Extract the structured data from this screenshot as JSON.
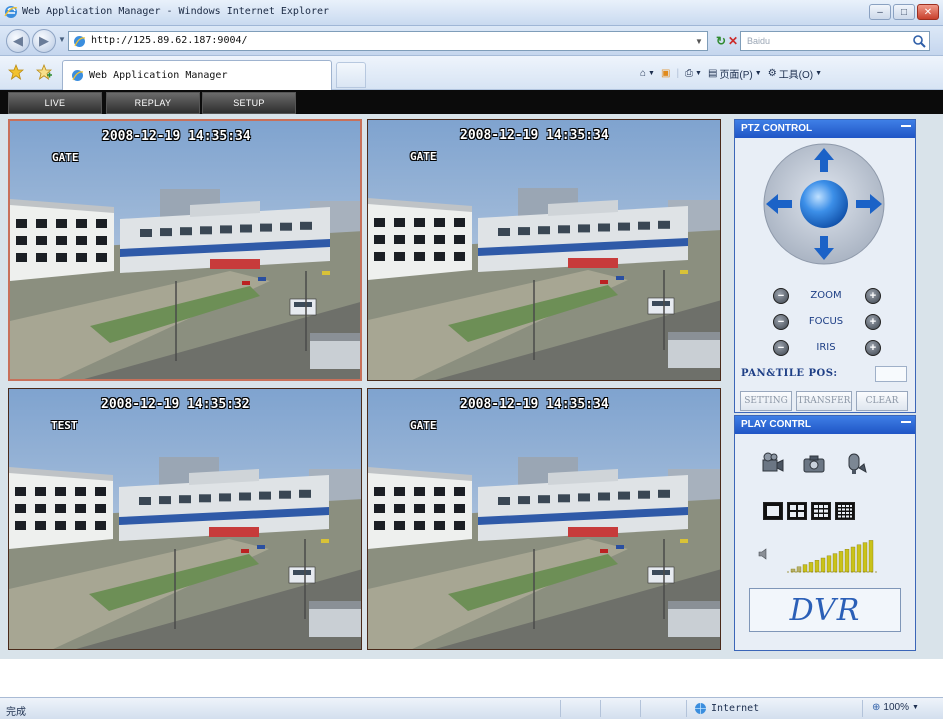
{
  "browser": {
    "window_title": "Web Application Manager - Windows Internet Explorer",
    "address": "http://125.89.62.187:9004/",
    "search_placeholder": "Baidu",
    "tab_title": "Web Application Manager",
    "commands": {
      "page": "页面(P)",
      "tools": "工具(O)"
    },
    "status": "完成",
    "zone": "Internet",
    "zoom": "100%"
  },
  "app": {
    "nav": [
      {
        "label": "LIVE"
      },
      {
        "label": "REPLAY"
      },
      {
        "label": "SETUP"
      }
    ],
    "cameras": [
      {
        "timestamp": "2008-12-19 14:35:34",
        "name": "GATE"
      },
      {
        "timestamp": "2008-12-19 14:35:34",
        "name": "GATE"
      },
      {
        "timestamp": "2008-12-19 14:35:32",
        "name": "TEST"
      },
      {
        "timestamp": "2008-12-19 14:35:34",
        "name": "GATE"
      }
    ],
    "ptz": {
      "title": "PTZ CONTROL",
      "zoom": "ZOOM",
      "focus": "FOCUS",
      "iris": "IRIS",
      "pan_tilt_label": "PAN&TILE POS:",
      "buttons": {
        "setting": "SETTING",
        "transfer": "TRANSFER",
        "clear": "CLEAR"
      }
    },
    "play": {
      "title": "PLAY CONTRL",
      "logo": "DVR"
    }
  },
  "colors": {
    "panel_header": "#1f55c5",
    "app_nav_bg": "#0b0b0b",
    "active_tile_border": "#c8705a"
  }
}
